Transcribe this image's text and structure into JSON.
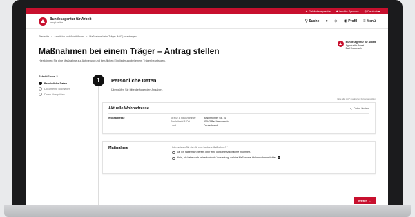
{
  "topbar": {
    "sign_language": "Gebärdensprache",
    "easy_language": "Leichte Sprache",
    "language": "Deutsch"
  },
  "header": {
    "brand": "Bundesagentur für Arbeit",
    "brand_sub": "bringt weiter",
    "search": "Suche",
    "profile": "Profil",
    "menu": "Menü"
  },
  "breadcrumb": [
    "Startseite",
    "Arbeitslos und Arbeit finden",
    "Maßnahme beim Träger (MAT) beantragen"
  ],
  "page": {
    "title": "Maßnahmen bei einem Träger – Antrag stellen",
    "intro": "Hier können Sie eine Maßnahme zur Aktivierung und beruflichen Eingliederung bei einem Träger beantragen."
  },
  "agency": {
    "name": "Bundesagentur für Arbeit",
    "line2": "Agentur für Arbeit",
    "line3": "Bad Kreuznach"
  },
  "steps": {
    "heading": "Schritt 1 von 3",
    "items": [
      {
        "label": "Persönliche Daten"
      },
      {
        "label": "Dokumente hochladen"
      },
      {
        "label": "Daten überprüfen"
      }
    ]
  },
  "step": {
    "number": "1",
    "title": "Persönliche Daten",
    "subtitle": "Überprüfen Sie bitte die folgenden Angaben.",
    "required_note": "Bitte alle mit * markierten Felder ausfüllen"
  },
  "address_card": {
    "title": "Aktuelle Wohnadresse",
    "edit": "Daten ändern",
    "label": "Wohnadresse",
    "keys": [
      "Straße & Hausnummer",
      "Postleitzahl & Ort",
      "Land"
    ],
    "values": [
      "Bosenheimer Str. 16",
      "55543 Bad Kreuznach",
      "Deutschland"
    ]
  },
  "measure_card": {
    "title": "Maßnahme",
    "question": "Interessieren Sie sich für eine konkrete Maßnahme? *",
    "option1": "Ja, ich habe mich bereits über eine konkrete Maßnahme informiert.",
    "option2": "Nein, ich habe noch keine konkrete Vorstellung, welche Maßnahme ich besuchen möchte."
  },
  "next_button": "Weiter"
}
